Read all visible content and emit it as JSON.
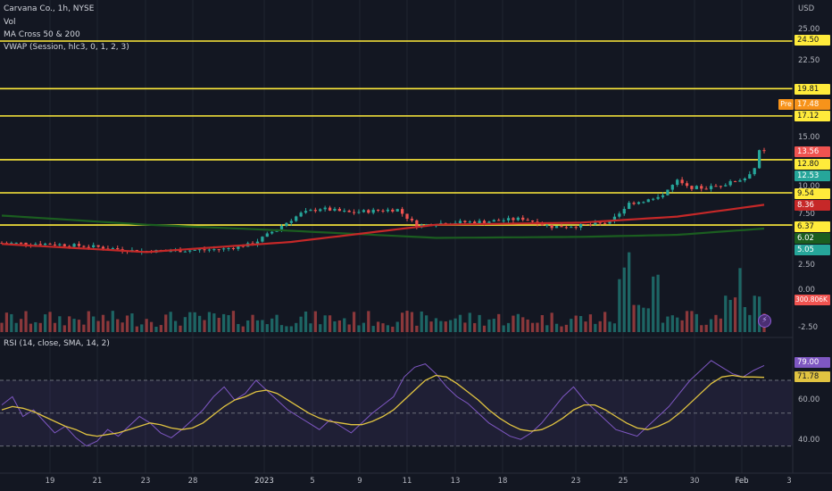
{
  "legend": {
    "symbol": "Carvana Co., 1h, NYSE",
    "volume": "Vol",
    "ma_cross": "MA Cross 50 & 200",
    "vwap": "VWAP (Session, hlc3, 0, 1, 2, 3)",
    "rsi": "RSI (14, close, SMA, 14, 2)"
  },
  "price_axis": {
    "currency": "USD",
    "ticks": [
      "25.00",
      "22.50",
      "15.00",
      "10.00",
      "7.50",
      "2.50",
      "0.00",
      "-2.50"
    ],
    "rsi_ticks": [
      "60.00",
      "40.00"
    ]
  },
  "horizontal_levels": [
    "24.50",
    "19.81",
    "17.12",
    "12.80",
    "9.54",
    "6.37"
  ],
  "badges": {
    "pre_label": "Pre",
    "pre_price": "17.48",
    "last_price": "13.56",
    "vwap_price": "12.53",
    "ma50": "8.36",
    "ma200": "6.02",
    "vwap_lower": "5.05",
    "volume": "300.806K",
    "rsi": "79.00",
    "rsi_ma": "71.78"
  },
  "colors": {
    "background": "#131722",
    "level_line": "#ffeb3b",
    "up": "#26a69a",
    "down": "#ef5350",
    "ma50": "#c62828",
    "ma200": "#1b5e20",
    "rsi": "#7e57c2",
    "rsi_ma": "#e0c341",
    "pre": "#f7931a"
  },
  "time_axis": [
    "19",
    "21",
    "23",
    "28",
    "2023",
    "5",
    "9",
    "11",
    "13",
    "18",
    "23",
    "25",
    "30",
    "Feb",
    "3"
  ],
  "chart_data": {
    "type": "candlestick",
    "symbol": "Carvana Co., 1h, NYSE",
    "y_unit": "USD",
    "horizontal_levels": [
      24.5,
      19.81,
      17.12,
      12.8,
      9.54,
      6.37
    ],
    "last_price": 13.56,
    "pre_market": 17.48,
    "close_path": [
      [
        0,
        4.6
      ],
      [
        10,
        4.5
      ],
      [
        20,
        4.2
      ],
      [
        28,
        3.8
      ],
      [
        34,
        3.8
      ],
      [
        40,
        3.9
      ],
      [
        46,
        4.0
      ],
      [
        52,
        4.5
      ],
      [
        58,
        6.3
      ],
      [
        62,
        7.5
      ],
      [
        66,
        8.0
      ],
      [
        72,
        7.6
      ],
      [
        78,
        7.8
      ],
      [
        82,
        7.9
      ],
      [
        86,
        6.3
      ],
      [
        92,
        6.6
      ],
      [
        100,
        6.7
      ],
      [
        108,
        7.0
      ],
      [
        114,
        6.2
      ],
      [
        120,
        6.3
      ],
      [
        126,
        6.6
      ],
      [
        130,
        8.5
      ],
      [
        136,
        9.0
      ],
      [
        140,
        10.7
      ],
      [
        142,
        10.1
      ],
      [
        146,
        10.0
      ],
      [
        150,
        10.4
      ],
      [
        154,
        11.0
      ],
      [
        156,
        12.0
      ],
      [
        157,
        13.6
      ],
      [
        158,
        13.56
      ]
    ],
    "ma50": [
      [
        0,
        4.5
      ],
      [
        30,
        3.7
      ],
      [
        60,
        4.7
      ],
      [
        90,
        6.4
      ],
      [
        120,
        6.6
      ],
      [
        140,
        7.2
      ],
      [
        158,
        8.36
      ]
    ],
    "ma200": [
      [
        0,
        7.3
      ],
      [
        30,
        6.4
      ],
      [
        60,
        5.8
      ],
      [
        90,
        5.1
      ],
      [
        120,
        5.2
      ],
      [
        140,
        5.4
      ],
      [
        158,
        6.02
      ]
    ],
    "rsi": {
      "label": "RSI (14, close, SMA, 14, 2)",
      "last": 79.0,
      "ma_last": 71.78,
      "levels": [
        70,
        50,
        30
      ],
      "values": [
        55,
        60,
        48,
        52,
        45,
        38,
        42,
        35,
        30,
        33,
        40,
        36,
        42,
        48,
        44,
        38,
        35,
        40,
        46,
        52,
        60,
        66,
        58,
        62,
        70,
        64,
        58,
        52,
        48,
        44,
        40,
        46,
        42,
        38,
        44,
        50,
        55,
        60,
        72,
        78,
        80,
        74,
        66,
        60,
        56,
        50,
        44,
        40,
        36,
        34,
        38,
        44,
        52,
        60,
        66,
        58,
        52,
        46,
        40,
        38,
        36,
        42,
        48,
        54,
        62,
        70,
        76,
        82,
        78,
        74,
        72,
        76,
        79
      ],
      "ma_values": [
        52,
        54,
        53,
        51,
        48,
        45,
        42,
        40,
        37,
        36,
        37,
        38,
        40,
        42,
        44,
        43,
        41,
        40,
        41,
        44,
        49,
        54,
        58,
        60,
        63,
        64,
        62,
        58,
        54,
        50,
        47,
        45,
        44,
        43,
        43,
        45,
        48,
        52,
        58,
        64,
        70,
        73,
        72,
        68,
        63,
        58,
        52,
        47,
        43,
        40,
        39,
        40,
        43,
        47,
        52,
        55,
        55,
        52,
        48,
        44,
        41,
        40,
        42,
        45,
        50,
        56,
        62,
        68,
        72,
        73,
        72,
        72,
        71.78
      ]
    },
    "x_ticks": [
      "19",
      "21",
      "23",
      "28",
      "2023",
      "5",
      "9",
      "11",
      "13",
      "18",
      "23",
      "25",
      "30",
      "Feb",
      "3"
    ]
  }
}
